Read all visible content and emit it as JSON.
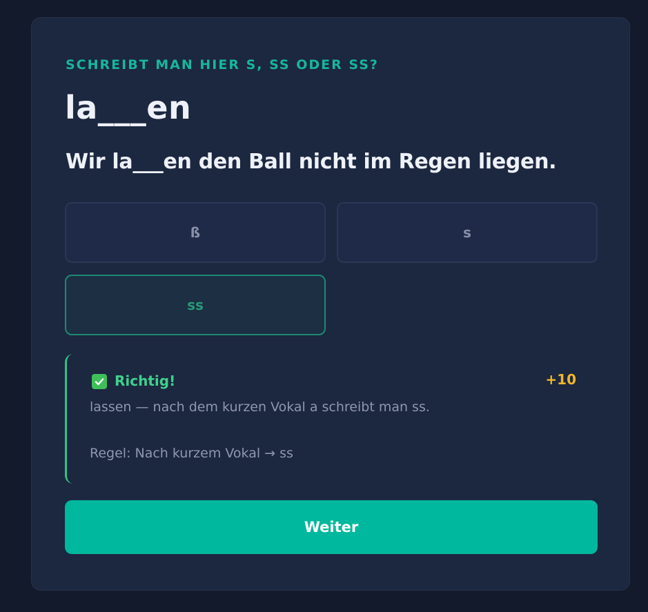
{
  "question": {
    "eyebrow": "SCHREIBT MAN HIER S, SS ODER SS?",
    "word": "la___en",
    "sentence": "Wir la___en den Ball nicht im Regen liegen."
  },
  "options": [
    {
      "label": "ß",
      "state": "default"
    },
    {
      "label": "s",
      "state": "default"
    },
    {
      "label": "ss",
      "state": "correct"
    }
  ],
  "feedback": {
    "icon": "check-box-icon",
    "title": "Richtig!",
    "points": "+10",
    "explanation": "lassen — nach dem kurzen Vokal a schreibt man ss.",
    "rule": "Regel: Nach kurzem Vokal → ss"
  },
  "actions": {
    "next_label": "Weiter"
  },
  "colors": {
    "accent": "#00b89d",
    "correct": "#3ed18b",
    "points": "#f1b62a",
    "background": "#131a2c",
    "card": "#1c2740"
  }
}
